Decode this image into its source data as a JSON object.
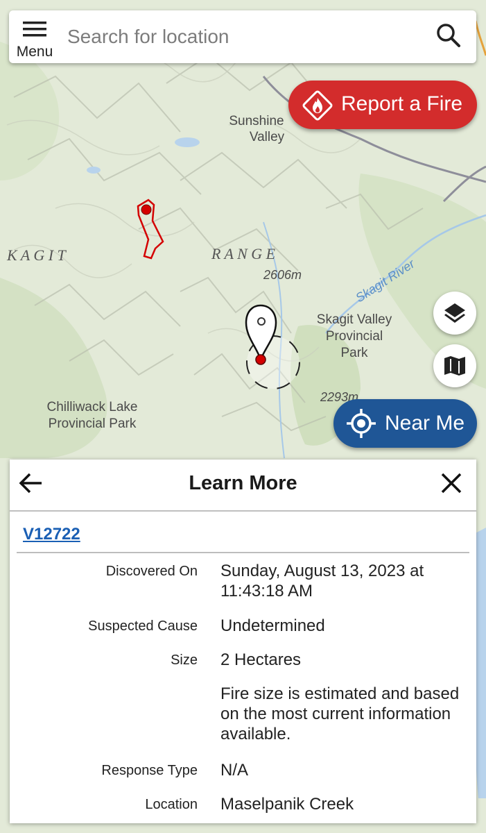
{
  "search": {
    "menu_label": "Menu",
    "placeholder": "Search for location"
  },
  "buttons": {
    "report_fire": "Report a Fire",
    "near_me": "Near Me"
  },
  "icons": {
    "menu": "hamburger-icon",
    "search": "search-icon",
    "report": "fire-icon",
    "layers": "layers-icon",
    "basemap": "map-icon",
    "near_me": "crosshair-icon",
    "back": "arrow-left-icon",
    "close": "close-icon",
    "marker": "map-pin-icon"
  },
  "colors": {
    "report": "#d32c2c",
    "near_me": "#1f5696",
    "link": "#1a5fb4",
    "fire_perimeter": "#d40000"
  },
  "map": {
    "labels": {
      "sunshine1": "Sunshine",
      "sunshine2": "Valley",
      "kagit": "K A G I T",
      "range": "R A N G E",
      "elev1": "2606m",
      "elev2": "2293m",
      "skagit_river": "Skagit River",
      "skagit_park1": "Skagit Valley",
      "skagit_park2": "Provincial",
      "skagit_park3": "Park",
      "chilliwack1": "Chilliwack Lake",
      "chilliwack2": "Provincial Park"
    }
  },
  "panel": {
    "title": "Learn More",
    "fire_id": "V12722",
    "details": [
      {
        "label": "Discovered On",
        "value": "Sunday, August 13, 2023 at 11:43:18 AM"
      },
      {
        "label": "Suspected Cause",
        "value": "Undetermined"
      },
      {
        "label": "Size",
        "value": "2 Hectares"
      },
      {
        "label": "",
        "value": "Fire size is estimated and based on the most current information available."
      },
      {
        "label": "Response Type",
        "value": "N/A"
      },
      {
        "label": "Location",
        "value": "Maselpanik Creek"
      }
    ]
  }
}
